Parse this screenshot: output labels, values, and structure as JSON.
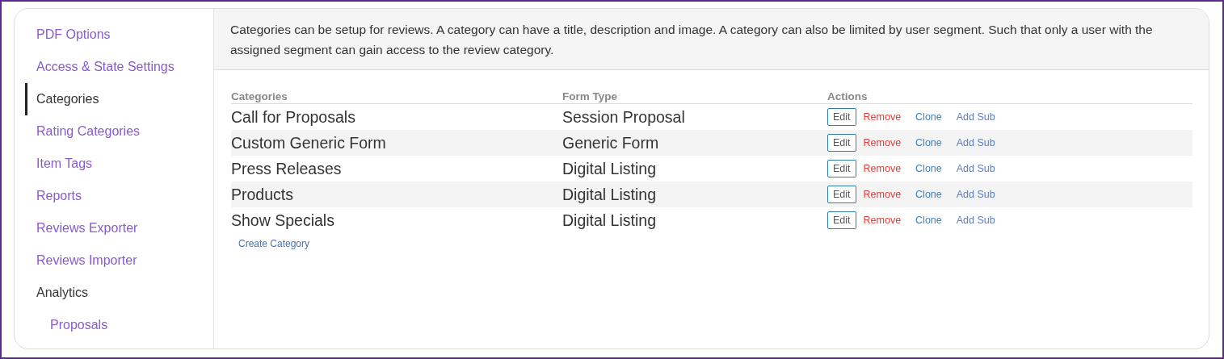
{
  "sidebar": {
    "items": [
      {
        "label": "PDF Options",
        "selected": false,
        "kind": "link"
      },
      {
        "label": "Access & State Settings",
        "selected": false,
        "kind": "link"
      },
      {
        "label": "Categories",
        "selected": true,
        "kind": "link"
      },
      {
        "label": "Rating Categories",
        "selected": false,
        "kind": "link"
      },
      {
        "label": "Item Tags",
        "selected": false,
        "kind": "link"
      },
      {
        "label": "Reports",
        "selected": false,
        "kind": "link"
      },
      {
        "label": "Reviews Exporter",
        "selected": false,
        "kind": "link"
      },
      {
        "label": "Reviews Importer",
        "selected": false,
        "kind": "link"
      },
      {
        "label": "Analytics",
        "selected": false,
        "kind": "heading",
        "children": [
          {
            "label": "Proposals",
            "selected": false
          }
        ]
      }
    ]
  },
  "description": "Categories can be setup for reviews. A category can have a title, description and image. A category can also be limited by user segment. Such that only a user with the assigned segment can gain access to the review category.",
  "table": {
    "columns": [
      "Categories",
      "Form Type",
      "Actions"
    ],
    "rows": [
      {
        "category": "Call for Proposals",
        "form_type": "Session Proposal",
        "actions": [
          "Edit",
          "Remove",
          "Clone",
          "Add Sub"
        ]
      },
      {
        "category": "Custom Generic Form",
        "form_type": "Generic Form",
        "actions": [
          "Edit",
          "Remove",
          "Clone",
          "Add Sub"
        ]
      },
      {
        "category": "Press Releases",
        "form_type": "Digital Listing",
        "actions": [
          "Edit",
          "Remove",
          "Clone",
          "Add Sub"
        ]
      },
      {
        "category": "Products",
        "form_type": "Digital Listing",
        "actions": [
          "Edit",
          "Remove",
          "Clone",
          "Add Sub"
        ]
      },
      {
        "category": "Show Specials",
        "form_type": "Digital Listing",
        "actions": [
          "Edit",
          "Remove",
          "Clone",
          "Add Sub"
        ]
      }
    ]
  },
  "create_link": "Create Category"
}
